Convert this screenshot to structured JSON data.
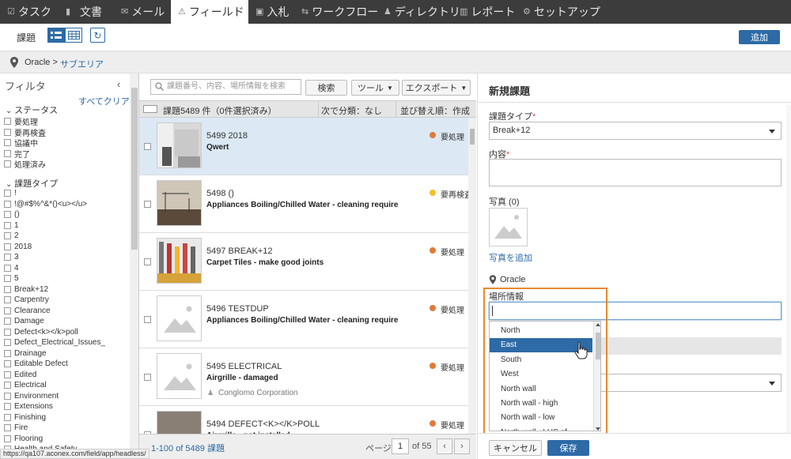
{
  "topnav": {
    "tabs": [
      {
        "label": "タスク",
        "icon": "checkbox-icon",
        "glyph": "☑"
      },
      {
        "label": "文書",
        "icon": "document-icon",
        "glyph": "▮"
      },
      {
        "label": "メール",
        "icon": "mail-icon",
        "glyph": "✉"
      },
      {
        "label": "フィールド",
        "icon": "warning-icon",
        "glyph": "⚠"
      },
      {
        "label": "入札",
        "icon": "bid-icon",
        "glyph": "▣"
      },
      {
        "label": "ワークフロー",
        "icon": "workflow-icon",
        "glyph": "⇆"
      },
      {
        "label": "ディレクトリ",
        "icon": "people-icon",
        "glyph": "♟"
      },
      {
        "label": "レポート",
        "icon": "chart-icon",
        "glyph": "▥"
      },
      {
        "label": "セットアップ",
        "icon": "gear-icon",
        "glyph": "⚙"
      }
    ],
    "active_index": 3
  },
  "subbar": {
    "title": "課題",
    "add_label": "追加"
  },
  "breadcrumb": {
    "root": "Oracle >",
    "sub": "サブエリア"
  },
  "filter": {
    "title": "フィルタ",
    "clear_all": "すべてクリア",
    "status_title": "ステータス",
    "status_items": [
      "要処理",
      "要再検査",
      "協議中",
      "完了",
      "処理済み"
    ],
    "type_title": "課題タイプ",
    "type_items": [
      "!",
      "!@#$%^&*()<u></u>",
      "()",
      "1",
      "2",
      "2018",
      "3",
      "4",
      "5",
      "Break+12",
      "Carpentry",
      "Clearance",
      "Damage",
      "Defect<k></k>poll",
      "Defect_Electrical_Issues_",
      "Drainage",
      "Editable Defect",
      "Edited",
      "Electrical",
      "Environment",
      "Extensions",
      "Finishing",
      "Fire",
      "Flooring",
      "Health and Safety"
    ]
  },
  "list": {
    "search_placeholder": "課題番号、内容、場所情報を検索",
    "search_button": "検索",
    "tools_button": "ツール",
    "export_button": "エクスポート",
    "count_text": "課題5489 件（0件選択済み）",
    "group_text": "次で分類：なし",
    "sort_text": "並び替え順：作成日",
    "rows": [
      {
        "num": "5499 2018",
        "title": "Qwert",
        "org": "",
        "status": "要処理",
        "status_color": "#e07a3a",
        "thumb": "office"
      },
      {
        "num": "5498 ()",
        "title": "Appliances Boiling/Chilled Water - cleaning require",
        "org": "",
        "status": "要再検査",
        "status_color": "#f0c030",
        "thumb": "crane"
      },
      {
        "num": "5497 BREAK+12",
        "title": "Carpet Tiles - make good joints",
        "org": "",
        "status": "要処理",
        "status_color": "#e07a3a",
        "thumb": "tools"
      },
      {
        "num": "5496 TESTDUP",
        "title": "Appliances Boiling/Chilled Water - cleaning require",
        "org": "",
        "status": "要処理",
        "status_color": "#e07a3a",
        "thumb": "placeholder"
      },
      {
        "num": "5495 ELECTRICAL",
        "title": "Airgrille - damaged",
        "org": "Conglomo Corporation",
        "status": "要処理",
        "status_color": "#e07a3a",
        "thumb": "placeholder"
      },
      {
        "num": "5494 DEFECT<K></K>POLL",
        "title": "Airgrille - not installed",
        "org": "",
        "status": "要処理",
        "status_color": "#e07a3a",
        "thumb": "wall"
      }
    ],
    "footer": {
      "range": "1-100 of 5489 課題",
      "page_label": "ページ",
      "page_value": "1",
      "of_text": "of 55"
    }
  },
  "statusbar": {
    "url": "https://qa107.aconex.com/field/app/headless/"
  },
  "form": {
    "header": "新規課題",
    "type_label": "課題タイプ",
    "type_value": "Break+12",
    "content_label": "内容",
    "photo_label": "写真 (0)",
    "add_photo": "写真を追加",
    "location_root": "Oracle",
    "location_label": "場所情報",
    "dropdown_items": [
      "North",
      "East",
      "South",
      "West",
      "North wall",
      "North wall - high",
      "North wall - low",
      "North wall - LHS of"
    ],
    "dropdown_highlight": 1,
    "cancel_label": "キャンセル",
    "save_label": "保存"
  }
}
